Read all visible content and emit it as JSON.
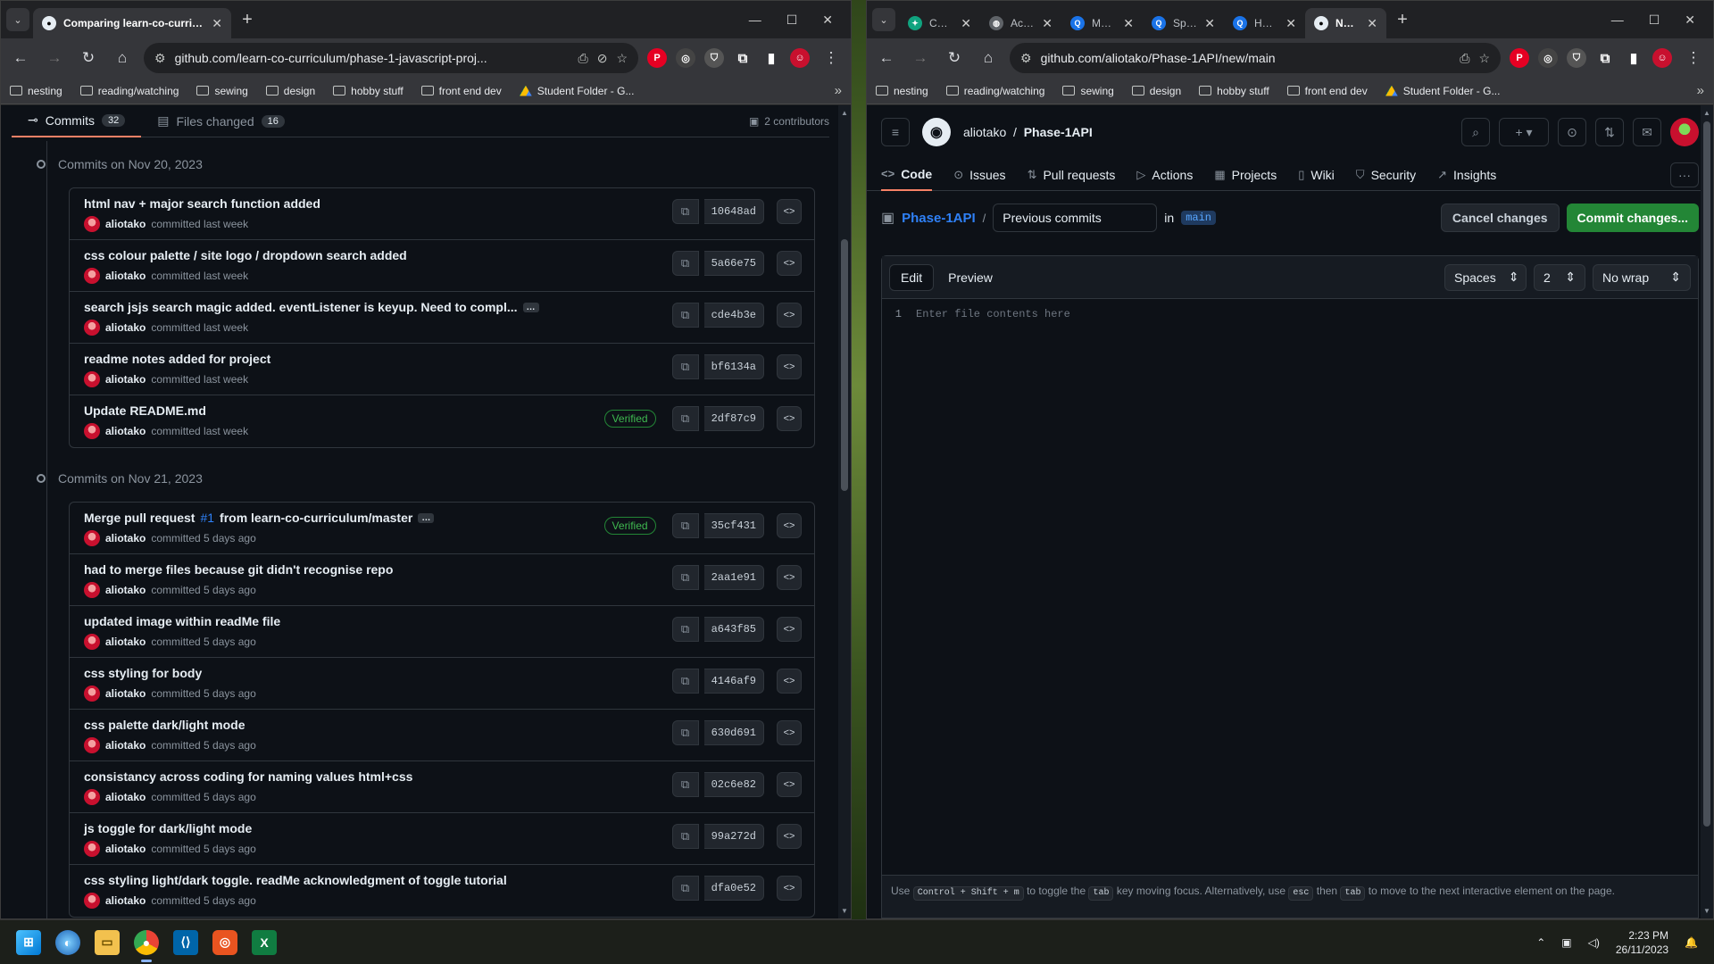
{
  "left": {
    "tabs": [
      {
        "title": "Comparing learn-co-curriculum",
        "active": true
      }
    ],
    "url": "github.com/learn-co-curriculum/phase-1-javascript-proj...",
    "page_tabs": {
      "commits_label": "Commits",
      "commits_count": "32",
      "files_label": "Files changed",
      "files_count": "16",
      "contributors": "2 contributors"
    },
    "groups": [
      {
        "date": "Commits on Nov 20, 2023",
        "commits": [
          {
            "title": "html nav + major search function added",
            "author": "aliotako",
            "when": "committed last week",
            "sha": "10648ad",
            "verified": ""
          },
          {
            "title": "css colour palette / site logo / dropdown search added",
            "author": "aliotako",
            "when": "committed last week",
            "sha": "5a66e75",
            "verified": ""
          },
          {
            "title": "search jsjs search magic added. eventListener is keyup. Need to compl...",
            "author": "aliotako",
            "when": "committed last week",
            "sha": "cde4b3e",
            "verified": "",
            "ellipsis": "…"
          },
          {
            "title": "readme notes added for project",
            "author": "aliotako",
            "when": "committed last week",
            "sha": "bf6134a",
            "verified": ""
          },
          {
            "title": "Update README.md",
            "author": "aliotako",
            "when": "committed last week",
            "sha": "2df87c9",
            "verified": "Verified"
          }
        ]
      },
      {
        "date": "Commits on Nov 21, 2023",
        "commits": [
          {
            "title": "Merge pull request",
            "link": "#1",
            "title2": "from learn-co-curriculum/master",
            "author": "aliotako",
            "when": "committed 5 days ago",
            "sha": "35cf431",
            "verified": "Verified",
            "ellipsis": "…"
          },
          {
            "title": "had to merge files because git didn't recognise repo",
            "author": "aliotako",
            "when": "committed 5 days ago",
            "sha": "2aa1e91",
            "verified": ""
          },
          {
            "title": "updated image within readMe file",
            "author": "aliotako",
            "when": "committed 5 days ago",
            "sha": "a643f85",
            "verified": ""
          },
          {
            "title": "css styling for body",
            "author": "aliotako",
            "when": "committed 5 days ago",
            "sha": "4146af9",
            "verified": ""
          },
          {
            "title": "css palette dark/light mode",
            "author": "aliotako",
            "when": "committed 5 days ago",
            "sha": "630d691",
            "verified": ""
          },
          {
            "title": "consistancy across coding for naming values html+css",
            "author": "aliotako",
            "when": "committed 5 days ago",
            "sha": "02c6e82",
            "verified": ""
          },
          {
            "title": "js toggle for dark/light mode",
            "author": "aliotako",
            "when": "committed 5 days ago",
            "sha": "99a272d",
            "verified": ""
          },
          {
            "title": "css styling light/dark toggle. readMe acknowledgment of toggle tutorial",
            "author": "aliotako",
            "when": "committed 5 days ago",
            "sha": "dfa0e52",
            "verified": ""
          }
        ]
      }
    ]
  },
  "right": {
    "tabs": [
      {
        "title": "ChatGP",
        "color": "#10a37f",
        "glyph": "✦"
      },
      {
        "title": "Academ",
        "color": "#5f6368",
        "glyph": "◍"
      },
      {
        "title": "Music A",
        "color": "#1a73e8",
        "glyph": "Q"
      },
      {
        "title": "Spotify",
        "color": "#1a73e8",
        "glyph": "Q"
      },
      {
        "title": "How to",
        "color": "#1a73e8",
        "glyph": "Q"
      },
      {
        "title": "New Fil",
        "color": "#e6edf3",
        "glyph": "●",
        "active": true
      }
    ],
    "url": "github.com/aliotako/Phase-1API/new/main",
    "owner": "aliotako",
    "repo": "Phase-1API",
    "nav": [
      {
        "label": "Code",
        "icon": "<>",
        "selected": true
      },
      {
        "label": "Issues",
        "icon": "⊙"
      },
      {
        "label": "Pull requests",
        "icon": "⇅"
      },
      {
        "label": "Actions",
        "icon": "▷"
      },
      {
        "label": "Projects",
        "icon": "▦"
      },
      {
        "label": "Wiki",
        "icon": "▯"
      },
      {
        "label": "Security",
        "icon": "⛉"
      },
      {
        "label": "Insights",
        "icon": "↗"
      }
    ],
    "path_repo": "Phase-1API",
    "filename": "Previous commits",
    "in_label": "in",
    "branch": "main",
    "cancel": "Cancel changes",
    "commit": "Commit changes...",
    "edit": "Edit",
    "preview": "Preview",
    "indent_mode": "Spaces",
    "indent_size": "2",
    "wrap": "No wrap",
    "line_number": "1",
    "placeholder": "Enter file contents here",
    "footer": {
      "use": "Use",
      "keys": "Control + Shift + m",
      "t1": "to toggle the",
      "tab": "tab",
      "t2": "key moving focus. Alternatively, use",
      "esc": "esc",
      "then": "then",
      "tab2": "tab",
      "t3": "to move to the next interactive element on the page."
    }
  },
  "bookmarks": [
    "nesting",
    "reading/watching",
    "sewing",
    "design",
    "hobby stuff",
    "front end dev",
    "Student Folder - G..."
  ],
  "taskbar": {
    "time": "2:23 PM",
    "date": "26/11/2023"
  }
}
